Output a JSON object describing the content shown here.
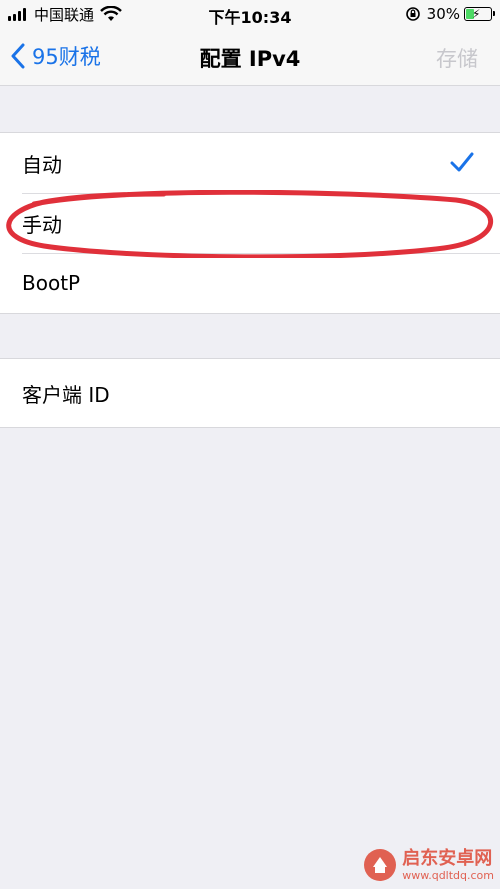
{
  "status_bar": {
    "carrier": "中国联通",
    "time": "下午10:34",
    "battery_percent": "30%",
    "battery_level": 0.3,
    "battery_color": "#4cd964"
  },
  "nav": {
    "back_label": "95财税",
    "title": "配置 IPv4",
    "save_label": "存储",
    "accent_color": "#1a73e8"
  },
  "config_options": [
    {
      "label": "自动",
      "selected": true
    },
    {
      "label": "手动",
      "selected": false
    },
    {
      "label": "BootP",
      "selected": false
    }
  ],
  "client_id": {
    "label": "客户端 ID"
  },
  "annotation": {
    "color": "#e0303a",
    "target": "手动"
  },
  "watermark": {
    "name": "启东安卓网",
    "url": "www.qdltdq.com"
  }
}
